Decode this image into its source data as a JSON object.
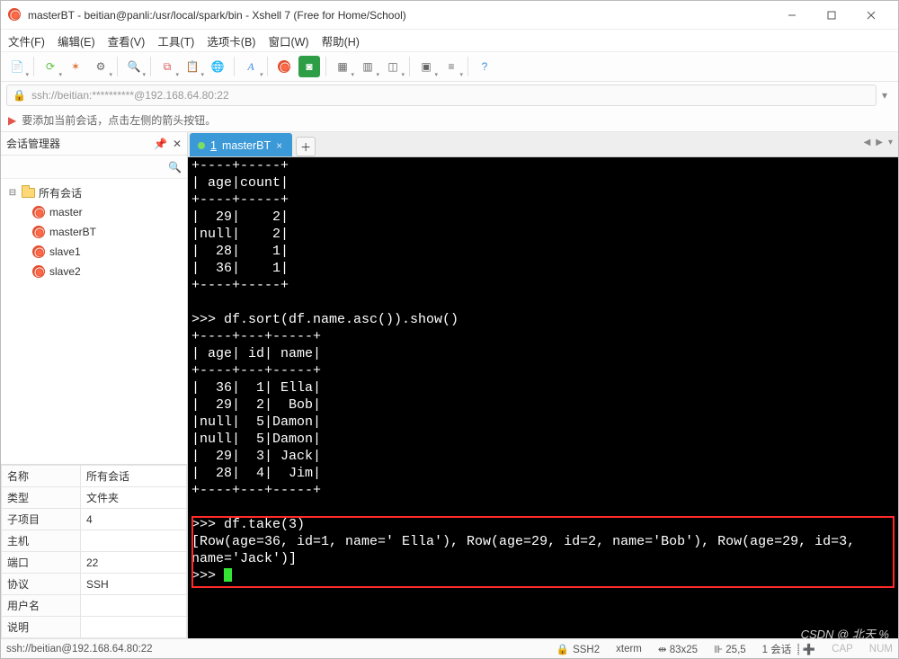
{
  "window": {
    "title": "masterBT - beitian@panli:/usr/local/spark/bin - Xshell 7 (Free for Home/School)"
  },
  "menu": [
    "文件(F)",
    "编辑(E)",
    "查看(V)",
    "工具(T)",
    "选项卡(B)",
    "窗口(W)",
    "帮助(H)"
  ],
  "address": {
    "url": "ssh://beitian:**********@192.168.64.80:22"
  },
  "hint": "要添加当前会话，点击左侧的箭头按钮。",
  "sidebar": {
    "title": "会话管理器",
    "root": "所有会话",
    "items": [
      "master",
      "masterBT",
      "slave1",
      "slave2"
    ]
  },
  "props": {
    "rows": [
      {
        "k": "名称",
        "v": "所有会话"
      },
      {
        "k": "类型",
        "v": "文件夹"
      },
      {
        "k": "子项目",
        "v": "4"
      },
      {
        "k": "主机",
        "v": ""
      },
      {
        "k": "端口",
        "v": "22"
      },
      {
        "k": "协议",
        "v": "SSH"
      },
      {
        "k": "用户名",
        "v": ""
      },
      {
        "k": "说明",
        "v": ""
      }
    ]
  },
  "tabs": {
    "active": {
      "label": "1 masterBT",
      "index": "1"
    }
  },
  "terminal": {
    "lines": [
      "+----+-----+",
      "| age|count|",
      "+----+-----+",
      "|  29|    2|",
      "|null|    2|",
      "|  28|    1|",
      "|  36|    1|",
      "+----+-----+",
      "",
      ">>> df.sort(df.name.asc()).show()",
      "+----+---+-----+",
      "| age| id| name|",
      "+----+---+-----+",
      "|  36|  1| Ella|",
      "|  29|  2|  Bob|",
      "|null|  5|Damon|",
      "|null|  5|Damon|",
      "|  29|  3| Jack|",
      "|  28|  4|  Jim|",
      "+----+---+-----+",
      "",
      ">>> df.take(3)",
      "[Row(age=36, id=1, name=' Ella'), Row(age=29, id=2, name='Bob'), Row(age=29, id=3, ",
      "name='Jack')]",
      ">>> "
    ]
  },
  "status": {
    "conn": "ssh://beitian@192.168.64.80:22",
    "proto": "SSH2",
    "termtype": "xterm",
    "size": "83x25",
    "pos": "25,5",
    "sessions": "1 会话",
    "cap": "CAP",
    "num": "NUM"
  },
  "watermark": "CSDN @ 北天 %",
  "chart_data": [
    {
      "type": "table",
      "title": "age count",
      "columns": [
        "age",
        "count"
      ],
      "rows": [
        [
          "29",
          2
        ],
        [
          "null",
          2
        ],
        [
          "28",
          1
        ],
        [
          "36",
          1
        ]
      ]
    },
    {
      "type": "table",
      "title": "df.sort(df.name.asc()).show()",
      "columns": [
        "age",
        "id",
        "name"
      ],
      "rows": [
        [
          36,
          1,
          "Ella"
        ],
        [
          29,
          2,
          "Bob"
        ],
        [
          "null",
          5,
          "Damon"
        ],
        [
          "null",
          5,
          "Damon"
        ],
        [
          29,
          3,
          "Jack"
        ],
        [
          28,
          4,
          "Jim"
        ]
      ]
    },
    {
      "type": "table",
      "title": "df.take(3)",
      "columns": [
        "age",
        "id",
        "name"
      ],
      "rows": [
        [
          36,
          1,
          " Ella"
        ],
        [
          29,
          2,
          "Bob"
        ],
        [
          29,
          3,
          "Jack"
        ]
      ]
    }
  ]
}
